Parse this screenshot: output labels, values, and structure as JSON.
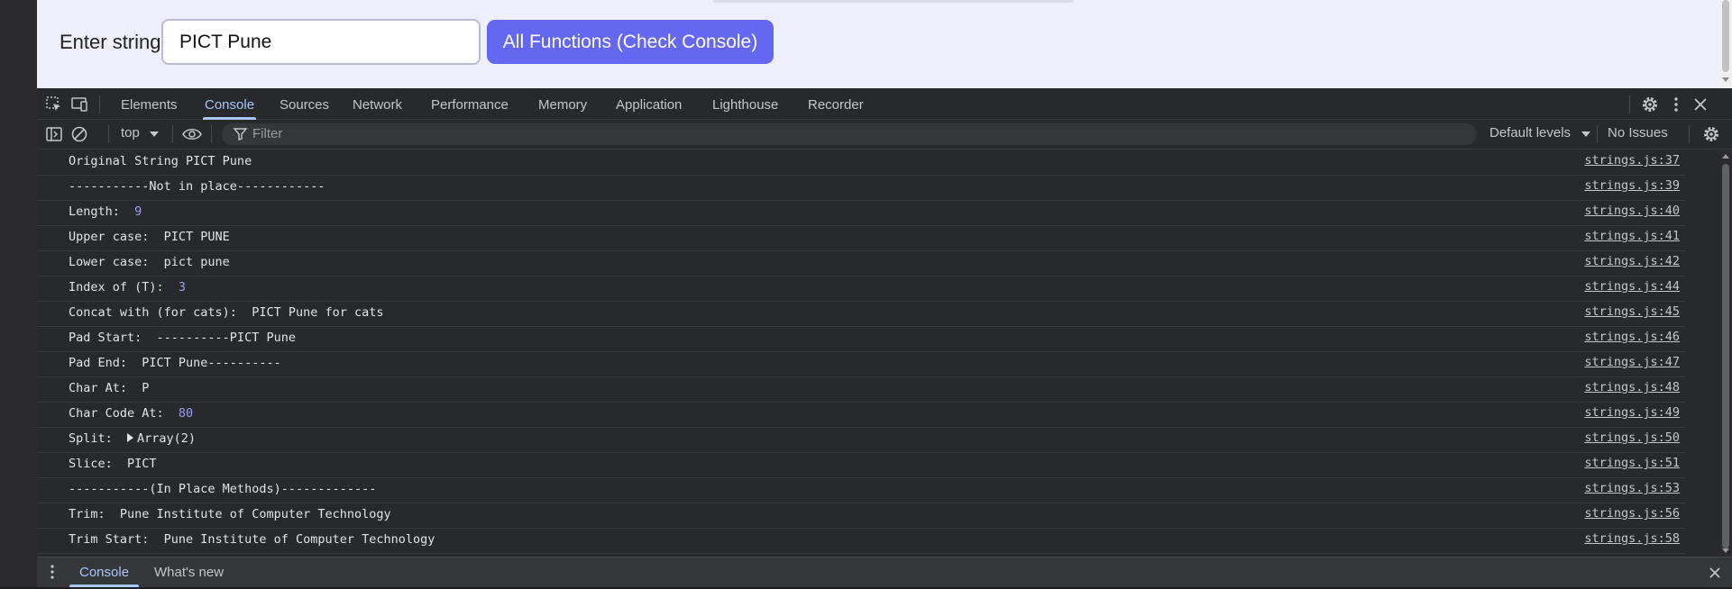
{
  "page": {
    "label": "Enter string:",
    "input_value": "PICT Pune",
    "button_label": "All Functions (Check Console)"
  },
  "devtools": {
    "tabs": [
      "Elements",
      "Console",
      "Sources",
      "Network",
      "Performance",
      "Memory",
      "Application",
      "Lighthouse",
      "Recorder"
    ],
    "active_tab": "Console",
    "filterbar": {
      "context": "top",
      "filter_placeholder": "Filter",
      "levels": "Default levels",
      "issues": "No Issues"
    },
    "logs": [
      {
        "label": "Original String PICT Pune",
        "value": "",
        "value_type": "",
        "source": "strings.js:37"
      },
      {
        "label": "-----------Not in place------------",
        "value": "",
        "value_type": "",
        "source": "strings.js:39"
      },
      {
        "label": "Length:  ",
        "value": "9",
        "value_type": "number",
        "source": "strings.js:40"
      },
      {
        "label": "Upper case:  PICT PUNE",
        "value": "",
        "value_type": "",
        "source": "strings.js:41"
      },
      {
        "label": "Lower case:  pict pune",
        "value": "",
        "value_type": "",
        "source": "strings.js:42"
      },
      {
        "label": "Index of (T):  ",
        "value": "3",
        "value_type": "number",
        "source": "strings.js:44"
      },
      {
        "label": "Concat with (for cats):  PICT Pune for cats",
        "value": "",
        "value_type": "",
        "source": "strings.js:45"
      },
      {
        "label": "Pad Start:  ----------PICT Pune",
        "value": "",
        "value_type": "",
        "source": "strings.js:46"
      },
      {
        "label": "Pad End:  PICT Pune----------",
        "value": "",
        "value_type": "",
        "source": "strings.js:47"
      },
      {
        "label": "Char At:  P",
        "value": "",
        "value_type": "",
        "source": "strings.js:48"
      },
      {
        "label": "Char Code At:  ",
        "value": "80",
        "value_type": "number",
        "source": "strings.js:49"
      },
      {
        "label": "Split:  ",
        "value": "Array(2)",
        "value_type": "object",
        "source": "strings.js:50"
      },
      {
        "label": "Slice:  PICT",
        "value": "",
        "value_type": "",
        "source": "strings.js:51"
      },
      {
        "label": "-----------(In Place Methods)-------------",
        "value": "",
        "value_type": "",
        "source": "strings.js:53"
      },
      {
        "label": "Trim:  Pune Institute of Computer Technology",
        "value": "",
        "value_type": "",
        "source": "strings.js:56"
      },
      {
        "label": "Trim Start:  Pune Institute of Computer Technology",
        "value": "",
        "value_type": "",
        "source": "strings.js:58"
      }
    ],
    "drawer": {
      "tabs": [
        "Console",
        "What's new"
      ],
      "active_tab": "Console"
    },
    "icons": [
      "inspect-element-icon",
      "device-toolbar-icon",
      "settings-gear-icon",
      "more-options-icon",
      "close-icon",
      "sidebar-toggle-icon",
      "clear-console-icon",
      "eye-icon",
      "filter-icon",
      "dropdown-arrow-icon"
    ]
  },
  "colors": {
    "page_bg": "#eeeffb",
    "button_bg": "#6467f2",
    "devtools_bg": "#28292d",
    "accent": "#a8c7fa",
    "number_value": "#9a9cf5"
  }
}
